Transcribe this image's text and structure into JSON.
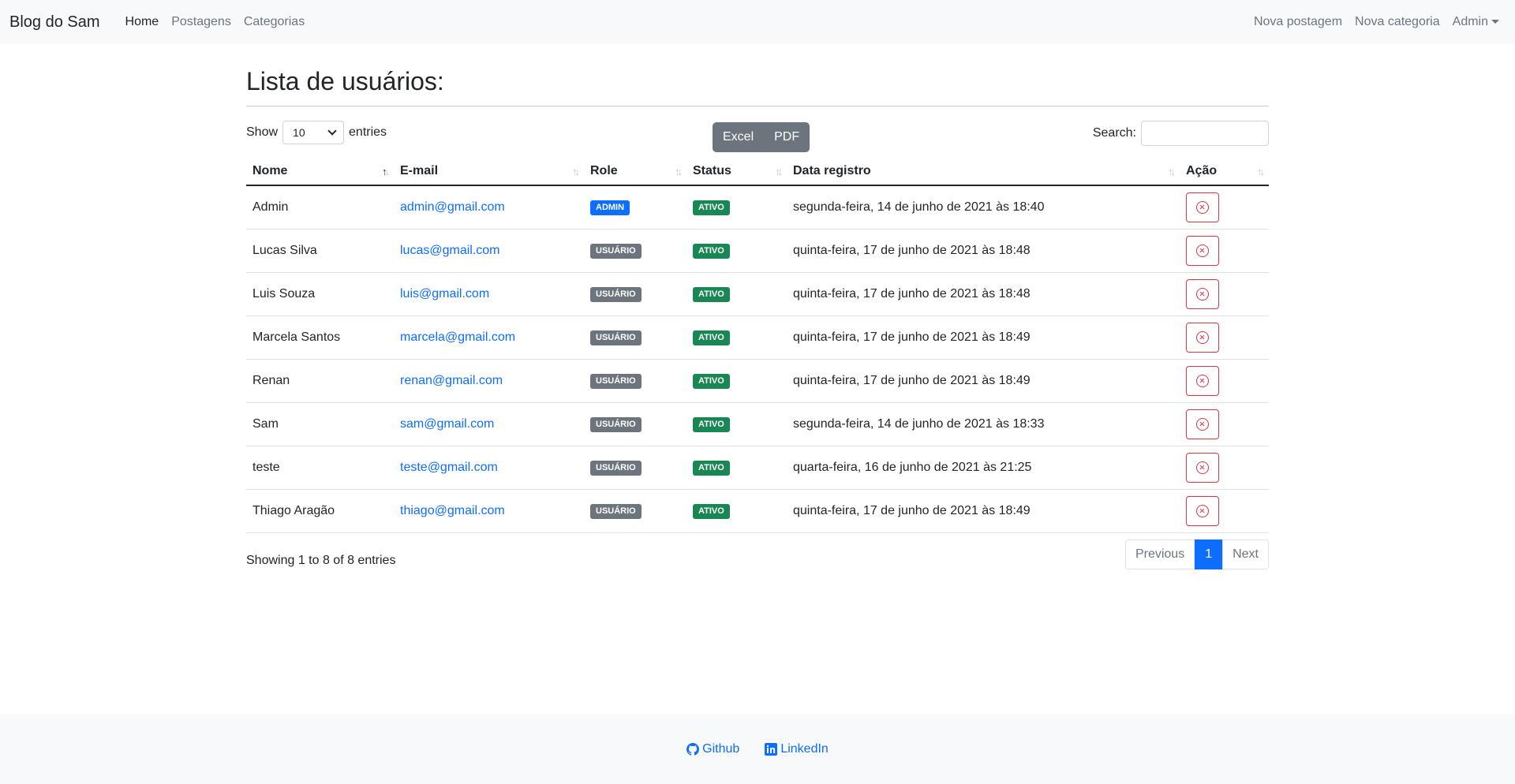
{
  "navbar": {
    "brand": "Blog do Sam",
    "links": [
      "Home",
      "Postagens",
      "Categorias"
    ],
    "right_links": [
      "Nova postagem",
      "Nova categoria"
    ],
    "admin_menu": "Admin"
  },
  "page": {
    "title": "Lista de usuários:"
  },
  "controls": {
    "show_label": "Show",
    "entries_value": "10",
    "entries_label": "entries",
    "export_excel": "Excel",
    "export_pdf": "PDF",
    "search_label": "Search:",
    "search_value": ""
  },
  "table": {
    "columns": [
      "Nome",
      "E-mail",
      "Role",
      "Status",
      "Data registro",
      "Ação"
    ],
    "rows": [
      {
        "nome": "Admin",
        "email": "admin@gmail.com",
        "role": "ADMIN",
        "status": "ATIVO",
        "data": "segunda-feira, 14 de junho de 2021 às 18:40"
      },
      {
        "nome": "Lucas Silva",
        "email": "lucas@gmail.com",
        "role": "USUÁRIO",
        "status": "ATIVO",
        "data": "quinta-feira, 17 de junho de 2021 às 18:48"
      },
      {
        "nome": "Luis Souza",
        "email": "luis@gmail.com",
        "role": "USUÁRIO",
        "status": "ATIVO",
        "data": "quinta-feira, 17 de junho de 2021 às 18:48"
      },
      {
        "nome": "Marcela Santos",
        "email": "marcela@gmail.com",
        "role": "USUÁRIO",
        "status": "ATIVO",
        "data": "quinta-feira, 17 de junho de 2021 às 18:49"
      },
      {
        "nome": "Renan",
        "email": "renan@gmail.com",
        "role": "USUÁRIO",
        "status": "ATIVO",
        "data": "quinta-feira, 17 de junho de 2021 às 18:49"
      },
      {
        "nome": "Sam",
        "email": "sam@gmail.com",
        "role": "USUÁRIO",
        "status": "ATIVO",
        "data": "segunda-feira, 14 de junho de 2021 às 18:33"
      },
      {
        "nome": "teste",
        "email": "teste@gmail.com",
        "role": "USUÁRIO",
        "status": "ATIVO",
        "data": "quarta-feira, 16 de junho de 2021 às 21:25"
      },
      {
        "nome": "Thiago Aragão",
        "email": "thiago@gmail.com",
        "role": "USUÁRIO",
        "status": "ATIVO",
        "data": "quinta-feira, 17 de junho de 2021 às 18:49"
      }
    ]
  },
  "table_footer": {
    "info": "Showing 1 to 8 of 8 entries",
    "previous": "Previous",
    "current_page": "1",
    "next": "Next"
  },
  "footer": {
    "github": "Github",
    "linkedin": "LinkedIn"
  },
  "colors": {
    "primary": "#0d6efd",
    "secondary": "#6c757d",
    "success": "#198754",
    "danger": "#dc3545"
  },
  "icons": {
    "delete": "x-circle-icon",
    "github": "github-icon",
    "linkedin": "linkedin-icon",
    "sort": "sort-icon"
  }
}
